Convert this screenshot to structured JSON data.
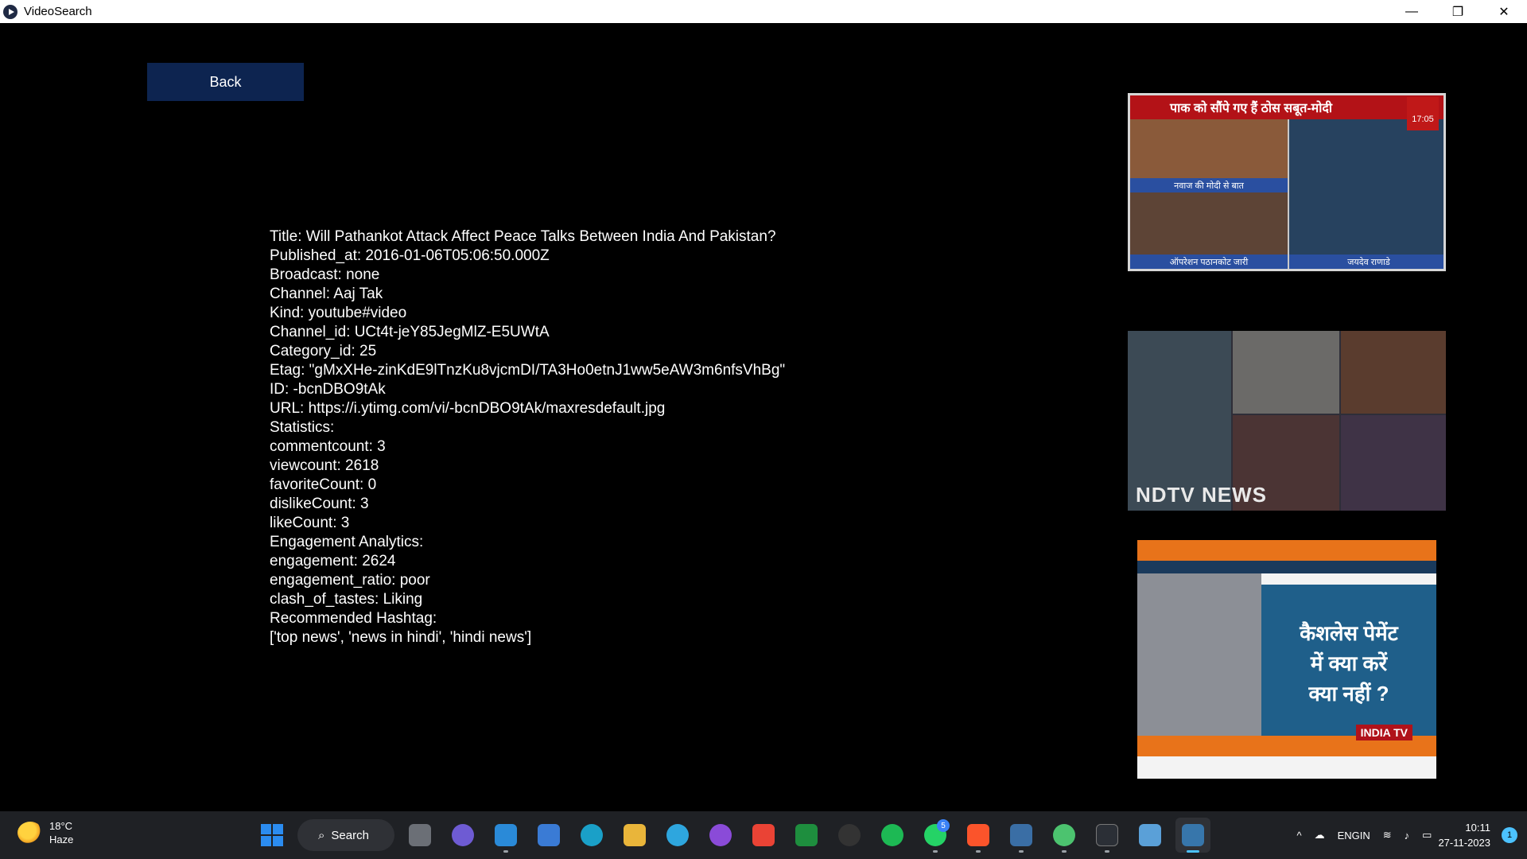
{
  "window": {
    "title": "VideoSearch",
    "controls": {
      "minimize": "—",
      "restore": "❐",
      "close": "✕"
    }
  },
  "back_button": {
    "label": "Back"
  },
  "details": [
    "Title: Will Pathankot Attack Affect Peace Talks Between India And Pakistan?",
    "Published_at: 2016-01-06T05:06:50.000Z",
    "Broadcast: none",
    "Channel: Aaj Tak",
    "Kind: youtube#video",
    "Channel_id: UCt4t-jeY85JegMlZ-E5UWtA",
    "Category_id: 25",
    "Etag: \"gMxXHe-zinKdE9lTnzKu8vjcmDI/TA3Ho0etnJ1ww5eAW3m6nfsVhBg\"",
    "ID: -bcnDBO9tAk",
    "URL: https://i.ytimg.com/vi/-bcnDBO9tAk/maxresdefault.jpg",
    "Statistics:",
    "commentcount: 3",
    "viewcount: 2618",
    "favoriteCount: 0",
    "dislikeCount: 3",
    "likeCount: 3",
    "Engagement Analytics:",
    "engagement: 2624",
    "engagement_ratio: poor",
    "clash_of_tastes: Liking",
    "Recommended Hashtag:",
    "['top news', 'news in hindi', 'hindi news']"
  ],
  "thumbnails": {
    "aajtak": {
      "banner": "पाक को सौंपे गए हैं ठोस सबूत-मोदी",
      "logo": "17:05",
      "caption_top": "नवाज की मोदी से बात",
      "caption_left": "ऑपरेशन पठानकोट जारी",
      "caption_right": "जयदेव राणाडे"
    },
    "ndtv": {
      "watermark": "NDTV NEWS"
    },
    "indiatv": {
      "headline_1": "कैशलेस पेमेंट",
      "headline_2": "में क्या करें",
      "headline_3": "क्या नहीं ?",
      "logo": "INDIA TV"
    }
  },
  "taskbar": {
    "weather": {
      "temp": "18°C",
      "condition": "Haze",
      "icon": "haze-sun-icon"
    },
    "search_label": "Search",
    "apps": [
      {
        "name": "start-icon",
        "color": "#2b8cf0"
      },
      {
        "name": "task-view-icon",
        "color": "#6b6f76"
      },
      {
        "name": "teams-chat-icon",
        "color": "#6e5bd3"
      },
      {
        "name": "vscode-icon",
        "color": "#2a8ad8"
      },
      {
        "name": "store-icon",
        "color": "#3a7bd5"
      },
      {
        "name": "edge-icon",
        "color": "#1aa0c8"
      },
      {
        "name": "file-explorer-icon",
        "color": "#e9b53a"
      },
      {
        "name": "telegram-icon",
        "color": "#2ea6de"
      },
      {
        "name": "podcast-icon",
        "color": "#8a4bd8"
      },
      {
        "name": "gmail-icon",
        "color": "#ea4335"
      },
      {
        "name": "classroom-icon",
        "color": "#1e8e3e"
      },
      {
        "name": "clock-app-icon",
        "color": "#333333"
      },
      {
        "name": "spotify-icon",
        "color": "#1db954"
      },
      {
        "name": "whatsapp-icon",
        "color": "#25d366"
      },
      {
        "name": "brave-icon",
        "color": "#fb542b"
      },
      {
        "name": "screen-tool-icon",
        "color": "#3a6ea5"
      },
      {
        "name": "maps-pin-icon",
        "color": "#4cc36f"
      },
      {
        "name": "terminal-icon",
        "color": "#2b2f36"
      },
      {
        "name": "snipping-icon",
        "color": "#5aa0d8"
      },
      {
        "name": "python-app-icon",
        "color": "#3776ab"
      }
    ],
    "whatsapp_badge": "5",
    "tray": {
      "chevron": "^",
      "lang_top": "ENG",
      "lang_bottom": "IN",
      "time": "10:11",
      "date": "27-11-2023",
      "notifications": "1"
    }
  }
}
